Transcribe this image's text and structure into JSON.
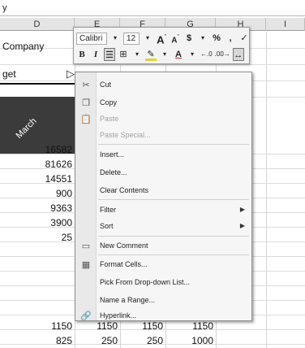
{
  "formula_bar": {
    "value": "y"
  },
  "columns": [
    {
      "letter": "D"
    },
    {
      "letter": "E"
    },
    {
      "letter": "F"
    },
    {
      "letter": "G"
    },
    {
      "letter": "H"
    },
    {
      "letter": "I"
    }
  ],
  "cells": {
    "company": "Company",
    "get": "get",
    "month": "March",
    "d_values": [
      "16582",
      "81626",
      "14551",
      "900",
      "9363",
      "3900",
      "25"
    ],
    "row_1150": [
      "1150",
      "1150",
      "1150",
      "1150"
    ],
    "row_825": [
      "825",
      "250",
      "250",
      "1000"
    ]
  },
  "mini_toolbar": {
    "font_name": "Calibri",
    "font_size": "12",
    "grow_font": "A",
    "shrink_font": "A",
    "currency": "$",
    "percent": "%",
    "comma": ",",
    "bold": "B",
    "italic": "I",
    "font_color": "A"
  },
  "context_menu": {
    "items": [
      {
        "label": "Cut",
        "icon": "scissors-icon",
        "disabled": false
      },
      {
        "label": "Copy",
        "icon": "copy-icon",
        "disabled": false
      },
      {
        "label": "Paste",
        "icon": "paste-icon",
        "disabled": true
      },
      {
        "label": "Paste Special...",
        "icon": "",
        "disabled": true
      },
      {
        "label": "Insert...",
        "icon": "",
        "disabled": false
      },
      {
        "label": "Delete...",
        "icon": "",
        "disabled": false
      },
      {
        "label": "Clear Contents",
        "icon": "",
        "disabled": false
      },
      {
        "label": "Filter",
        "icon": "",
        "disabled": false,
        "submenu": true
      },
      {
        "label": "Sort",
        "icon": "",
        "disabled": false,
        "submenu": true
      },
      {
        "label": "New Comment",
        "icon": "comment-icon",
        "disabled": false
      },
      {
        "label": "Format Cells...",
        "icon": "format-cells-icon",
        "disabled": false
      },
      {
        "label": "Pick From Drop-down List...",
        "icon": "",
        "disabled": false
      },
      {
        "label": "Name a Range...",
        "icon": "",
        "disabled": false
      },
      {
        "label": "Hyperlink...",
        "icon": "hyperlink-icon",
        "disabled": false
      }
    ]
  }
}
